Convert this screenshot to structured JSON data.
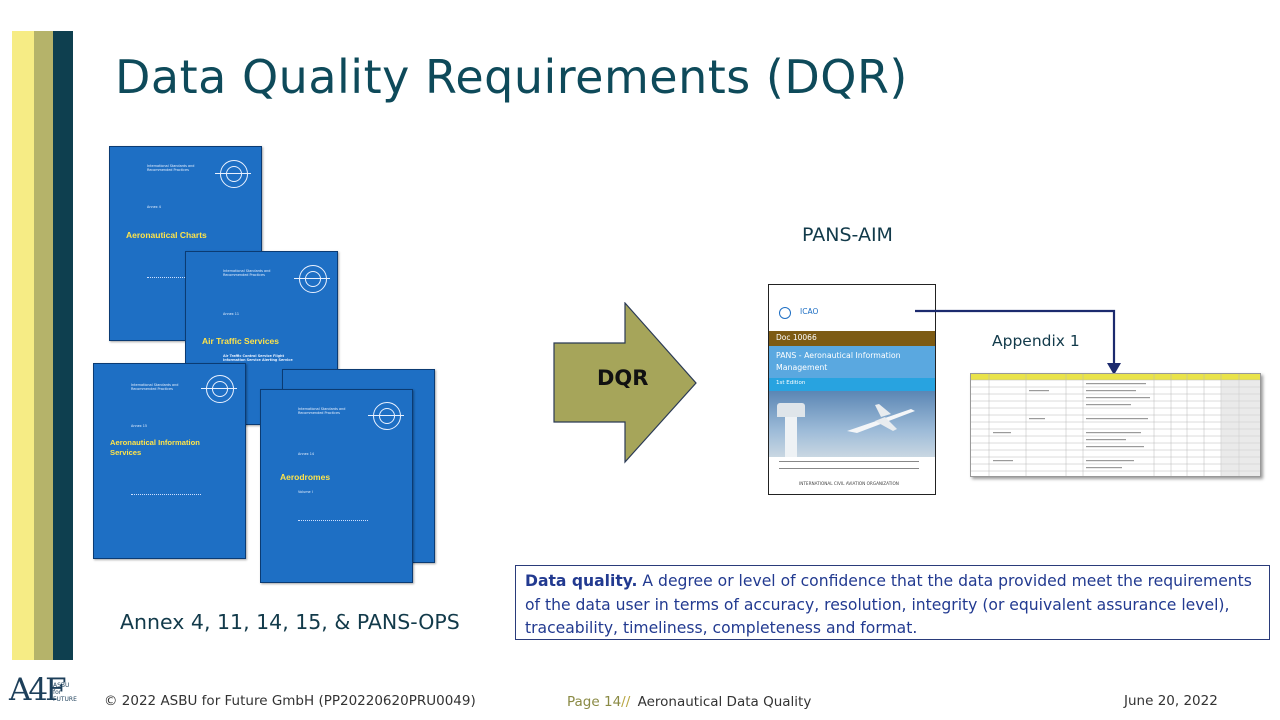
{
  "colors": {
    "stripe_yellow": "#f6ec85",
    "stripe_olive": "#b5b36a",
    "stripe_teal": "#0e3f4f",
    "title_color": "#0e4a5a",
    "cover_blue": "#1e6fc4",
    "cover_heading_yellow": "#ffe44a",
    "arrow_olive": "#a6a55a",
    "definition_text": "#223a90"
  },
  "slide": {
    "title": "Data Quality Requirements (DQR)"
  },
  "annex_covers": [
    {
      "publisher": "International Standards and Recommended Practices",
      "annex": "Annex 4",
      "heading": "Aeronautical Charts"
    },
    {
      "publisher": "International Standards and Recommended Practices",
      "annex": "Annex 11",
      "heading": "Air Traffic Services",
      "subheading": "Air Traffic Control Service Flight Information Service Alerting Service"
    },
    {
      "publisher": "International Standards and Recommended Practices",
      "annex": "Annex 15",
      "heading": "Aeronautical Information Services"
    },
    {
      "publisher": "International Standards and Recommended Practices",
      "annex": "Annex 14",
      "heading": "Aerodromes",
      "volume": "Volume I"
    }
  ],
  "annex_caption": "Annex 4, 11, 14, 15, & PANS-OPS",
  "arrow": {
    "label": "DQR"
  },
  "pans_aim": {
    "label": "PANS-AIM",
    "cover": {
      "org": "ICAO",
      "doc_number": "Doc 10066",
      "title": "PANS - Aeronautical Information Management",
      "edition": "1st Edition",
      "footer": "INTERNATIONAL CIVIL AVIATION ORGANIZATION"
    }
  },
  "appendix": {
    "label": "Appendix 1"
  },
  "definition": {
    "term": "Data quality.",
    "text": " A degree or level of confidence that the data provided meet the requirements of the data user in terms of accuracy, resolution, integrity (or equivalent assurance level), traceability, timeliness, completeness and format."
  },
  "footer": {
    "logo_mark": "A4F",
    "logo_text": "ASBU for FUTURE",
    "copyright": "© 2022 ASBU for Future GmbH (PP20220620PRU0049)",
    "page_label": "Page",
    "page_number": "14",
    "separator": "//",
    "subject": "Aeronautical Data Quality",
    "date": "June 20, 2022"
  }
}
